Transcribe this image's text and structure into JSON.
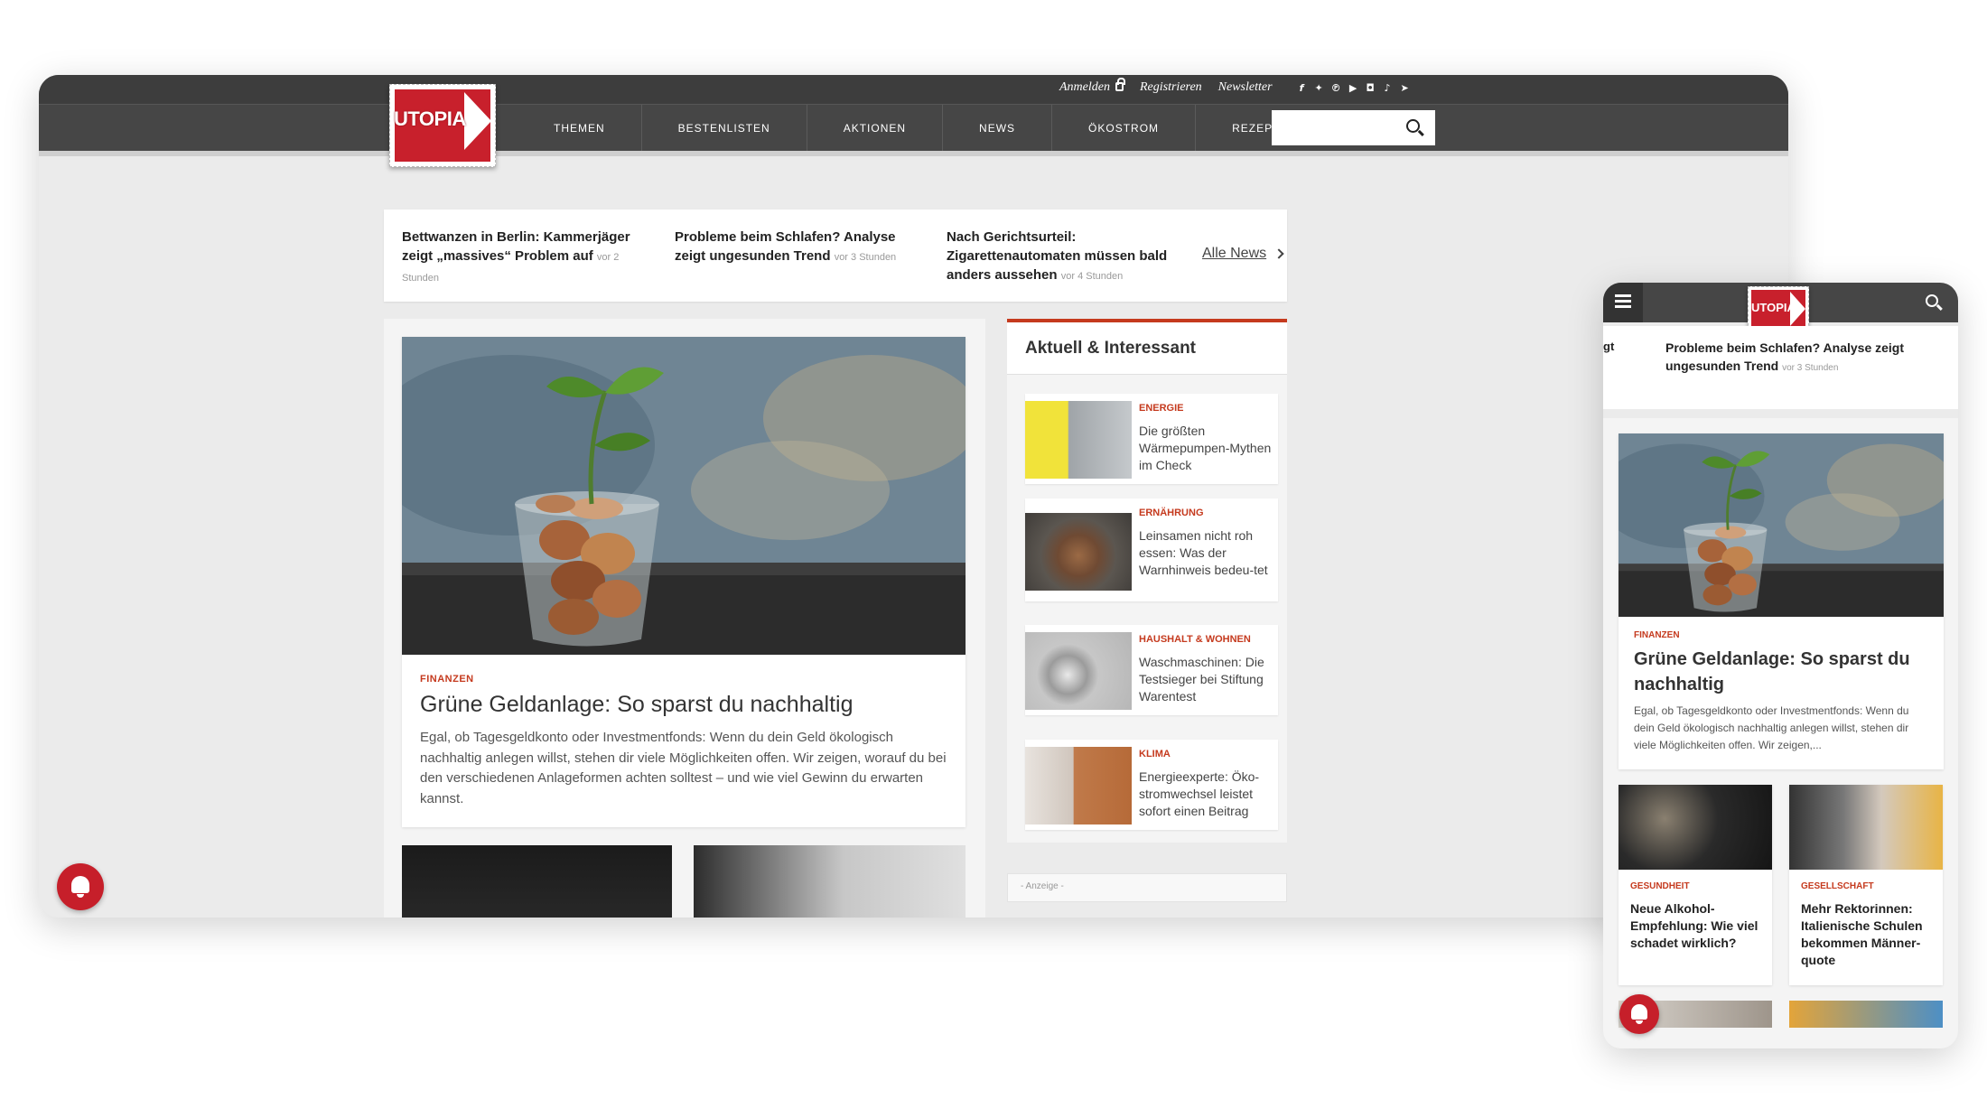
{
  "desktop": {
    "top_links": {
      "anmelden": "Anmelden",
      "registrieren": "Registrieren",
      "newsletter": "Newsletter"
    },
    "social_icons": [
      "facebook-icon",
      "twitter-icon",
      "pinterest-icon",
      "youtube-icon",
      "instagram-icon",
      "tiktok-icon",
      "telegram-icon"
    ],
    "logo_text": "UTOPIA",
    "nav": [
      "THEMEN",
      "BESTENLISTEN",
      "AKTIONEN",
      "NEWS",
      "ÖKOSTROM",
      "REZEPTE"
    ],
    "search": {
      "placeholder": ""
    },
    "ticker": [
      {
        "title": "Bettwanzen in Berlin: Kammerjäger zeigt „massives“ Problem auf",
        "time": "vor 2 Stunden"
      },
      {
        "title": "Probleme beim Schlafen? Analyse zeigt ungesunden Trend",
        "time": "vor 3 Stunden"
      },
      {
        "title": "Nach Gerichtsurteil: Zigarettenautomaten müssen bald anders aussehen",
        "time": "vor 4 Stunden"
      }
    ],
    "all_news": "Alle News",
    "hero": {
      "category": "FINANZEN",
      "title": "Grüne Geldanlage: So sparst du nachhaltig",
      "text": "Egal, ob Tagesgeldkonto oder Investmentfonds: Wenn du dein Geld ökologisch nachhaltig anlegen willst, stehen dir viele Möglichkeiten offen. Wir zeigen, worauf du bei den verschiedenen Anlageformen achten solltest – und wie viel Gewinn du erwarten kannst."
    },
    "sidebar": {
      "heading": "Aktuell & Interessant",
      "items": [
        {
          "category": "ENERGIE",
          "title": "Die größten Wärmepumpen-Mythen im Check"
        },
        {
          "category": "ERNÄHRUNG",
          "title": "Leinsamen nicht roh essen: Was der Warnhinweis bedeu-tet"
        },
        {
          "category": "HAUSHALT & WOHNEN",
          "title": "Waschmaschinen: Die Testsieger bei Stiftung Warentest"
        },
        {
          "category": "KLIMA",
          "title": "Energieexperte: Öko-stromwechsel leistet sofort einen Beitrag"
        }
      ]
    },
    "ad_label": "- Anzeige -"
  },
  "mobile": {
    "logo_text": "UTOPIA",
    "ticker_fragment": "gt",
    "ticker": {
      "title": "Probleme beim Schlafen? Analyse zeigt ungesunden Trend",
      "time": "vor 3 Stunden"
    },
    "hero": {
      "category": "FINANZEN",
      "title": "Grüne Geldanlage: So sparst du nachhaltig",
      "text": "Egal, ob Tagesgeldkonto oder Investmentfonds: Wenn du dein Geld ökologisch nachhaltig anlegen willst, stehen dir viele Möglichkeiten offen. Wir zeigen,..."
    },
    "cards": [
      {
        "category": "GESUNDHEIT",
        "title": "Neue Alkohol-Empfehlung: Wie viel schadet wirklich?"
      },
      {
        "category": "GESELLSCHAFT",
        "title": "Mehr Rektorinnen: Italienische Schulen bekommen Männer-quote"
      }
    ]
  },
  "colors": {
    "accent": "#c53a1e",
    "brand_red": "#c8202c",
    "header": "#464646"
  }
}
